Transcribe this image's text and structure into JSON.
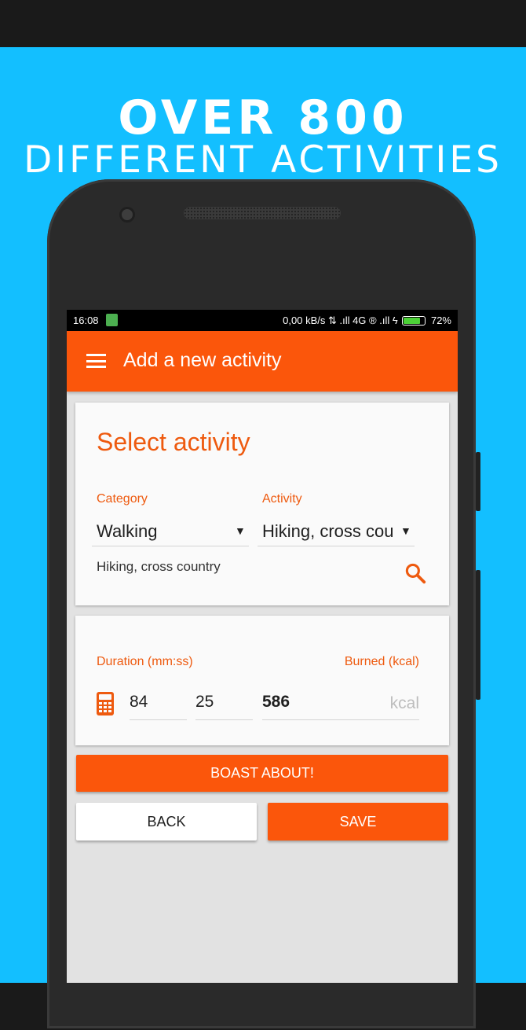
{
  "promo": {
    "headline": "OVER 800",
    "subline": "DIFFERENT ACTIVITIES",
    "background": "#13bfff"
  },
  "statusbar": {
    "time": "16:08",
    "network_info": "0,00 kB/s ⇅ .ıll 4G ® .ıll ϟ",
    "battery_percent": "72%",
    "battery_level": 0.72
  },
  "appbar": {
    "title": "Add a new activity",
    "menu_icon": "hamburger-menu-icon",
    "color": "#fb560b"
  },
  "select_card": {
    "title": "Select activity",
    "category_label": "Category",
    "category_value": "Walking",
    "activity_label": "Activity",
    "activity_value": "Hiking, cross cou",
    "dropdown_arrow": "▼",
    "selected_activity": "Hiking, cross country",
    "search_icon": "search-icon"
  },
  "duration_card": {
    "duration_label": "Duration (mm:ss)",
    "burned_label": "Burned (kcal)",
    "minutes": "84",
    "seconds": "25",
    "kcal_value": "586",
    "kcal_unit": "kcal",
    "calculator_icon": "calculator-icon"
  },
  "buttons": {
    "boast": "BOAST ABOUT!",
    "back": "BACK",
    "save": "SAVE"
  }
}
